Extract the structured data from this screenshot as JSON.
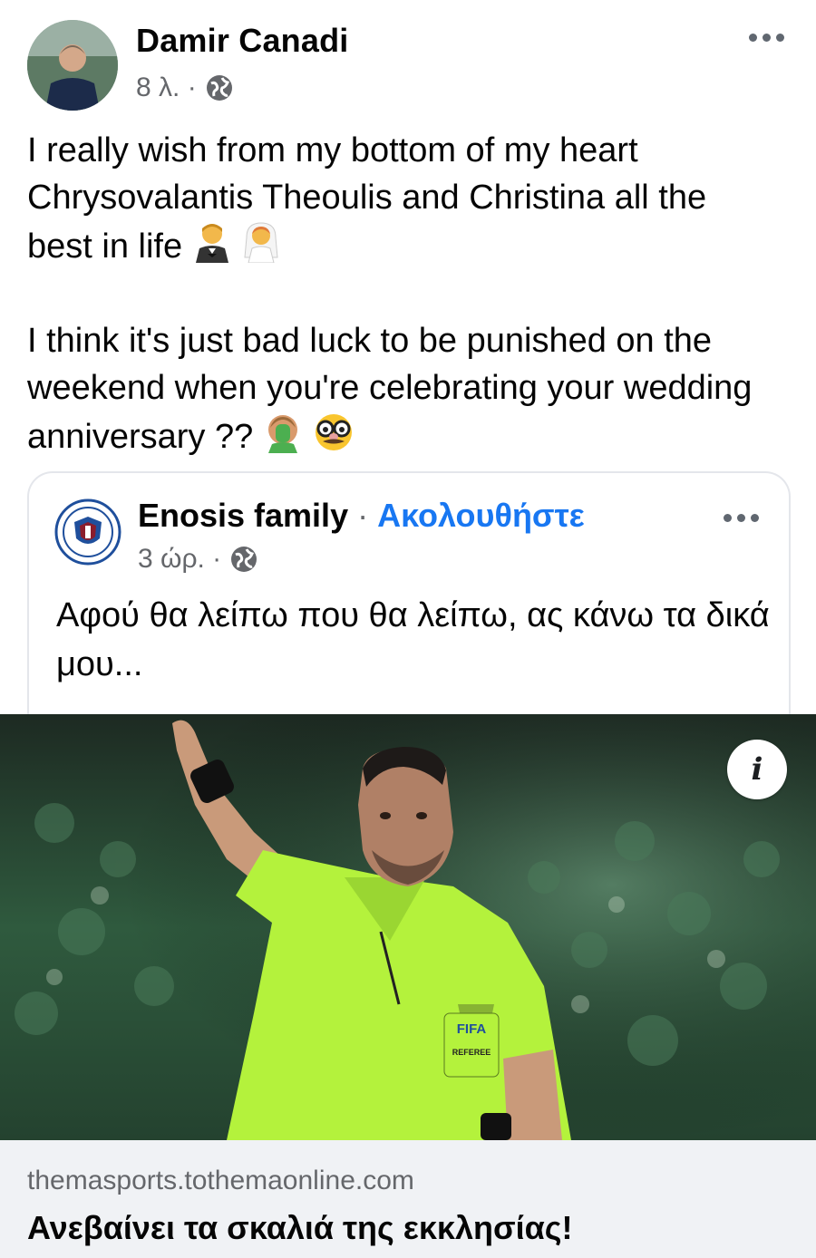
{
  "post": {
    "author": "Damir Canadi",
    "time": "8 λ. ·",
    "text": {
      "line1": "I really wish from my bottom of my heart",
      "line2": "Chrysovalantis Theoulis and Christina all the",
      "line3": "best in life",
      "line4": "I think it's just bad luck to be punished on the",
      "line5": "weekend when you're celebrating your wedding",
      "line6": "anniversary ??"
    }
  },
  "shared_post": {
    "page_name": "Enosis family",
    "separator": " · ",
    "follow_label": "Ακολουθήστε",
    "time": "3 ώρ. ·",
    "text": "Αφού θα λείπω που θα λείπω, ας κάνω τα δικά μου..."
  },
  "link": {
    "domain": "themasports.tothemaonline.com",
    "headline": "Ανεβαίνει τα σκαλιά της εκκλησίας!",
    "info_glyph": "i",
    "jersey_text": "FIFA",
    "badge_text": "REFEREE"
  },
  "icons": [
    "globe-icon",
    "more-options-icon",
    "groom-emoji",
    "bride-emoji",
    "facepalm-emoji",
    "disguise-emoji",
    "info-icon"
  ],
  "colors": {
    "accent": "#1877f2",
    "meta": "#65676b",
    "link_bg": "#f0f2f5",
    "jersey": "#b4f23c"
  }
}
